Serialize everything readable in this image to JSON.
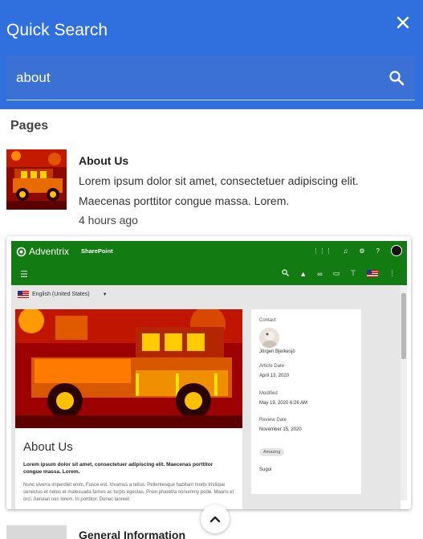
{
  "panel": {
    "title": "Quick Search",
    "close_icon": "close-icon"
  },
  "search": {
    "value": "about",
    "icon": "search-icon"
  },
  "section": {
    "title": "Pages"
  },
  "results": [
    {
      "title": "About Us",
      "description": "Lorem ipsum dolor sit amet, consectetuer adipiscing elit. Maecenas porttitor congue massa. Lorem.",
      "time": "4 hours ago"
    },
    {
      "title": "General Information"
    }
  ],
  "preview": {
    "brand": "Adventrix",
    "app": "SharePoint",
    "language": "English (United States)",
    "page_title": "About Us",
    "lead": "Lorem ipsum dolor sit amet, consectetuer adipiscing elit. Maecenas porttitor congue massa. Lorem.",
    "body": "Nunc viverra imperdiet enim. Fusce est. Vivamus a tellus. Pellentesque habitant morbi tristique senectus et netus et malesuada fames ac turpis egestas. Proin pharetra nonummy pede. Mauris et orci. Aenean nec lorem. In porttitor. Donec laoreet",
    "side": {
      "contact_label": "Contact",
      "contact_name": "Jörgen Bjerkesjö",
      "article_date_label": "Article Date",
      "article_date": "April 13, 2020",
      "modified_label": "Modified",
      "modified": "May 19, 2020 6:26 AM",
      "review_label": "Review Date",
      "review": "November 15, 2020",
      "tag": "Amazing",
      "extra": "Sugoi"
    }
  },
  "colors": {
    "header": "#2f6fde",
    "search_box": "#3b70d4",
    "preview_bar": "#127b12"
  }
}
